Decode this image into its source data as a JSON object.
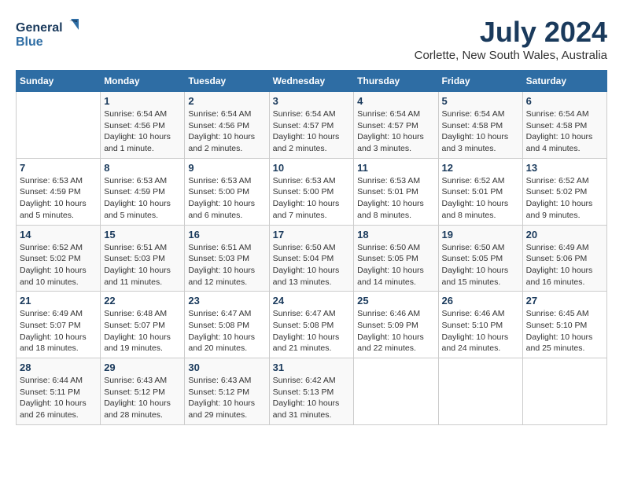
{
  "header": {
    "logo_line1": "General",
    "logo_line2": "Blue",
    "month_year": "July 2024",
    "location": "Corlette, New South Wales, Australia"
  },
  "days_of_week": [
    "Sunday",
    "Monday",
    "Tuesday",
    "Wednesday",
    "Thursday",
    "Friday",
    "Saturday"
  ],
  "weeks": [
    [
      null,
      {
        "num": "1",
        "sunrise": "6:54 AM",
        "sunset": "4:56 PM",
        "daylight": "10 hours and 1 minute."
      },
      {
        "num": "2",
        "sunrise": "6:54 AM",
        "sunset": "4:56 PM",
        "daylight": "10 hours and 2 minutes."
      },
      {
        "num": "3",
        "sunrise": "6:54 AM",
        "sunset": "4:57 PM",
        "daylight": "10 hours and 2 minutes."
      },
      {
        "num": "4",
        "sunrise": "6:54 AM",
        "sunset": "4:57 PM",
        "daylight": "10 hours and 3 minutes."
      },
      {
        "num": "5",
        "sunrise": "6:54 AM",
        "sunset": "4:58 PM",
        "daylight": "10 hours and 3 minutes."
      },
      {
        "num": "6",
        "sunrise": "6:54 AM",
        "sunset": "4:58 PM",
        "daylight": "10 hours and 4 minutes."
      }
    ],
    [
      {
        "num": "7",
        "sunrise": "6:53 AM",
        "sunset": "4:59 PM",
        "daylight": "10 hours and 5 minutes."
      },
      {
        "num": "8",
        "sunrise": "6:53 AM",
        "sunset": "4:59 PM",
        "daylight": "10 hours and 5 minutes."
      },
      {
        "num": "9",
        "sunrise": "6:53 AM",
        "sunset": "5:00 PM",
        "daylight": "10 hours and 6 minutes."
      },
      {
        "num": "10",
        "sunrise": "6:53 AM",
        "sunset": "5:00 PM",
        "daylight": "10 hours and 7 minutes."
      },
      {
        "num": "11",
        "sunrise": "6:53 AM",
        "sunset": "5:01 PM",
        "daylight": "10 hours and 8 minutes."
      },
      {
        "num": "12",
        "sunrise": "6:52 AM",
        "sunset": "5:01 PM",
        "daylight": "10 hours and 8 minutes."
      },
      {
        "num": "13",
        "sunrise": "6:52 AM",
        "sunset": "5:02 PM",
        "daylight": "10 hours and 9 minutes."
      }
    ],
    [
      {
        "num": "14",
        "sunrise": "6:52 AM",
        "sunset": "5:02 PM",
        "daylight": "10 hours and 10 minutes."
      },
      {
        "num": "15",
        "sunrise": "6:51 AM",
        "sunset": "5:03 PM",
        "daylight": "10 hours and 11 minutes."
      },
      {
        "num": "16",
        "sunrise": "6:51 AM",
        "sunset": "5:03 PM",
        "daylight": "10 hours and 12 minutes."
      },
      {
        "num": "17",
        "sunrise": "6:50 AM",
        "sunset": "5:04 PM",
        "daylight": "10 hours and 13 minutes."
      },
      {
        "num": "18",
        "sunrise": "6:50 AM",
        "sunset": "5:05 PM",
        "daylight": "10 hours and 14 minutes."
      },
      {
        "num": "19",
        "sunrise": "6:50 AM",
        "sunset": "5:05 PM",
        "daylight": "10 hours and 15 minutes."
      },
      {
        "num": "20",
        "sunrise": "6:49 AM",
        "sunset": "5:06 PM",
        "daylight": "10 hours and 16 minutes."
      }
    ],
    [
      {
        "num": "21",
        "sunrise": "6:49 AM",
        "sunset": "5:07 PM",
        "daylight": "10 hours and 18 minutes."
      },
      {
        "num": "22",
        "sunrise": "6:48 AM",
        "sunset": "5:07 PM",
        "daylight": "10 hours and 19 minutes."
      },
      {
        "num": "23",
        "sunrise": "6:47 AM",
        "sunset": "5:08 PM",
        "daylight": "10 hours and 20 minutes."
      },
      {
        "num": "24",
        "sunrise": "6:47 AM",
        "sunset": "5:08 PM",
        "daylight": "10 hours and 21 minutes."
      },
      {
        "num": "25",
        "sunrise": "6:46 AM",
        "sunset": "5:09 PM",
        "daylight": "10 hours and 22 minutes."
      },
      {
        "num": "26",
        "sunrise": "6:46 AM",
        "sunset": "5:10 PM",
        "daylight": "10 hours and 24 minutes."
      },
      {
        "num": "27",
        "sunrise": "6:45 AM",
        "sunset": "5:10 PM",
        "daylight": "10 hours and 25 minutes."
      }
    ],
    [
      {
        "num": "28",
        "sunrise": "6:44 AM",
        "sunset": "5:11 PM",
        "daylight": "10 hours and 26 minutes."
      },
      {
        "num": "29",
        "sunrise": "6:43 AM",
        "sunset": "5:12 PM",
        "daylight": "10 hours and 28 minutes."
      },
      {
        "num": "30",
        "sunrise": "6:43 AM",
        "sunset": "5:12 PM",
        "daylight": "10 hours and 29 minutes."
      },
      {
        "num": "31",
        "sunrise": "6:42 AM",
        "sunset": "5:13 PM",
        "daylight": "10 hours and 31 minutes."
      },
      null,
      null,
      null
    ]
  ]
}
